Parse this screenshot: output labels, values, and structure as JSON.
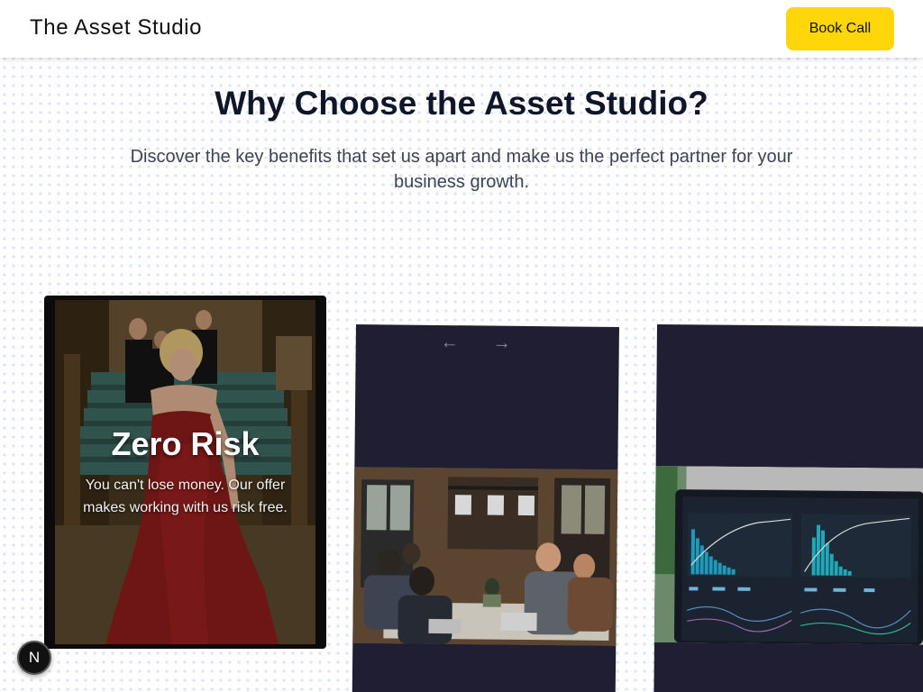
{
  "navbar": {
    "brand": "The Asset Studio",
    "cta_label": "Book Call"
  },
  "hero": {
    "title": "Why Choose the Asset Studio?",
    "subtitle": "Discover the key benefits that set us apart and make us the perfect partner for your business growth."
  },
  "cards": [
    {
      "title": "Zero Risk",
      "description": "You can't lose money. Our offer makes working with us risk free."
    }
  ],
  "carousel": {
    "prev_icon": "arrow-left-icon",
    "next_icon": "arrow-right-icon",
    "prev_glyph": "←",
    "next_glyph": "→"
  },
  "floating_badge": {
    "letter": "N"
  },
  "colors": {
    "accent": "#ffd60a",
    "card_dark": "#1f1e33",
    "headline": "#0f1629"
  }
}
